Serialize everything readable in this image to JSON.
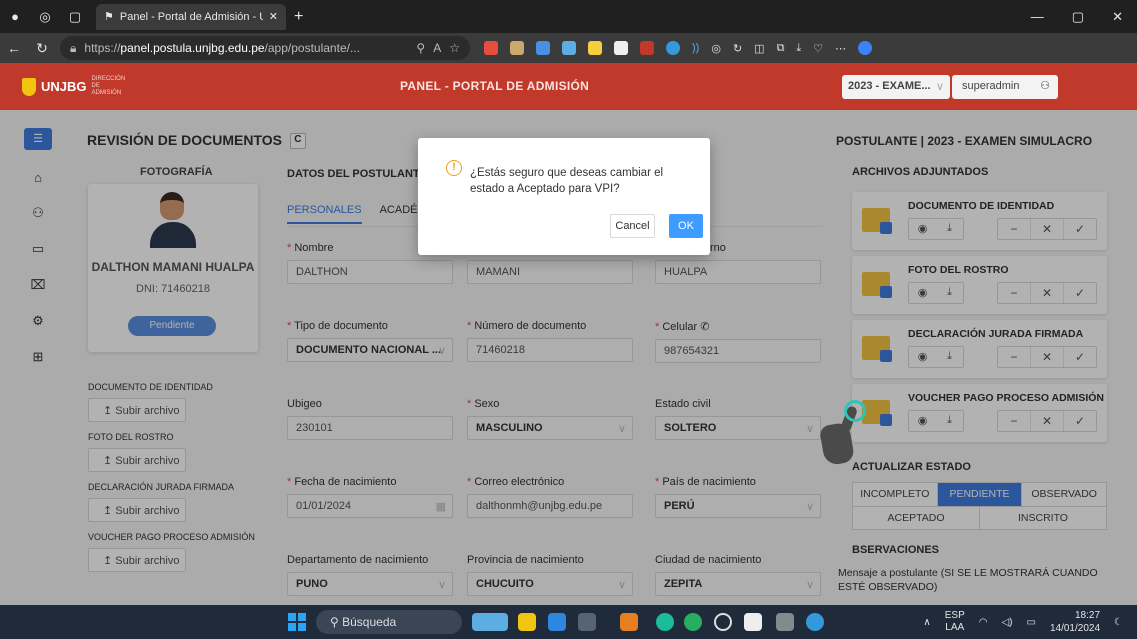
{
  "browser": {
    "tab_title": "Panel - Portal de Admisión - UN…",
    "url_prefix": "https://",
    "url_domain": "panel.postula.unjbg.edu.pe",
    "url_path": "/app/postulante/...",
    "window_minimize": "—",
    "window_restore": "▢",
    "window_close": "✕"
  },
  "header": {
    "logo_text": "UNJBG",
    "logo_sub": "DIRECCIÓN DE ADMISIÓN",
    "title": "PANEL - PORTAL DE ADMISIÓN",
    "exam_select": "2023 - EXAME...",
    "user": "superadmin"
  },
  "page": {
    "title": "REVISIÓN DE DOCUMENTOS",
    "refresh_label": "C",
    "foto_label": "FOTOGRAFÍA",
    "name": "DALTHON MAMANI HUALPA",
    "dni": "DNI: 71460218",
    "status": "Pendiente",
    "upload_label": "↥ Subir archivo",
    "docs": [
      "DOCUMENTO DE IDENTIDAD",
      "FOTO DEL ROSTRO",
      "DECLARACIÓN JURADA FIRMADA",
      "VOUCHER PAGO PROCESO ADMISIÓN"
    ]
  },
  "datos": {
    "title": "DATOS DEL POSTULANTE",
    "tabs": [
      "PERSONALES",
      "ACADÉMI"
    ],
    "fields": {
      "nombre": {
        "label": "Nombre",
        "value": "DALTHON"
      },
      "apellido_p": {
        "label": "",
        "value": "MAMANI"
      },
      "apellido_m": {
        "label": "rno",
        "value": "HUALPA"
      },
      "tipo_doc": {
        "label": "Tipo de documento",
        "value": "DOCUMENTO NACIONAL ..."
      },
      "num_doc": {
        "label": "Número de documento",
        "value": "71460218"
      },
      "celular": {
        "label": "Celular",
        "value": "987654321"
      },
      "ubigeo": {
        "label": "Ubigeo",
        "value": "230101"
      },
      "sexo": {
        "label": "Sexo",
        "value": "MASCULINO"
      },
      "estado_civil": {
        "label": "Estado civil",
        "value": "SOLTERO"
      },
      "fecha_nac": {
        "label": "Fecha de nacimiento",
        "value": "01/01/2024"
      },
      "correo": {
        "label": "Correo electrónico",
        "value": "dalthonmh@unjbg.edu.pe"
      },
      "pais": {
        "label": "País de nacimiento",
        "value": "PERÚ"
      },
      "departamento": {
        "label": "Departamento de nacimiento",
        "value": "PUNO"
      },
      "provincia": {
        "label": "Provincia de nacimiento",
        "value": "CHUCUITO"
      },
      "ciudad": {
        "label": "Ciudad de nacimiento",
        "value": "ZEPITA"
      }
    }
  },
  "right": {
    "title": "POSTULANTE | 2023 - EXAMEN SIMULACRO",
    "archivos_title": "ARCHIVOS ADJUNTADOS",
    "files": [
      "DOCUMENTO DE IDENTIDAD",
      "FOTO DEL ROSTRO",
      "DECLARACIÓN JURADA FIRMADA",
      "VOUCHER PAGO PROCESO ADMISIÓN"
    ],
    "estado_title": "ACTUALIZAR ESTADO",
    "estados_row1": [
      "INCOMPLETO",
      "PENDIENTE",
      "OBSERVADO"
    ],
    "estados_row2": [
      "ACEPTADO",
      "INSCRITO"
    ],
    "selected_estado": "PENDIENTE",
    "obs_title": "BSERVACIONES",
    "obs_text": "Mensaje a postulante (SI SE LE MOSTRARÁ CUANDO ESTÉ OBSERVADO)"
  },
  "modal": {
    "message": "¿Estás seguro que deseas cambiar el estado a Aceptado para VPI?",
    "cancel": "Cancel",
    "ok": "OK"
  },
  "taskbar": {
    "search_placeholder": "Búsqueda",
    "lang": "ESP",
    "lang_sub": "LAA",
    "time": "18:27",
    "date": "14/01/2024"
  },
  "colors": {
    "brand_red": "#c0392b",
    "accent_blue": "#3e7be0",
    "warning": "#f0a020"
  }
}
